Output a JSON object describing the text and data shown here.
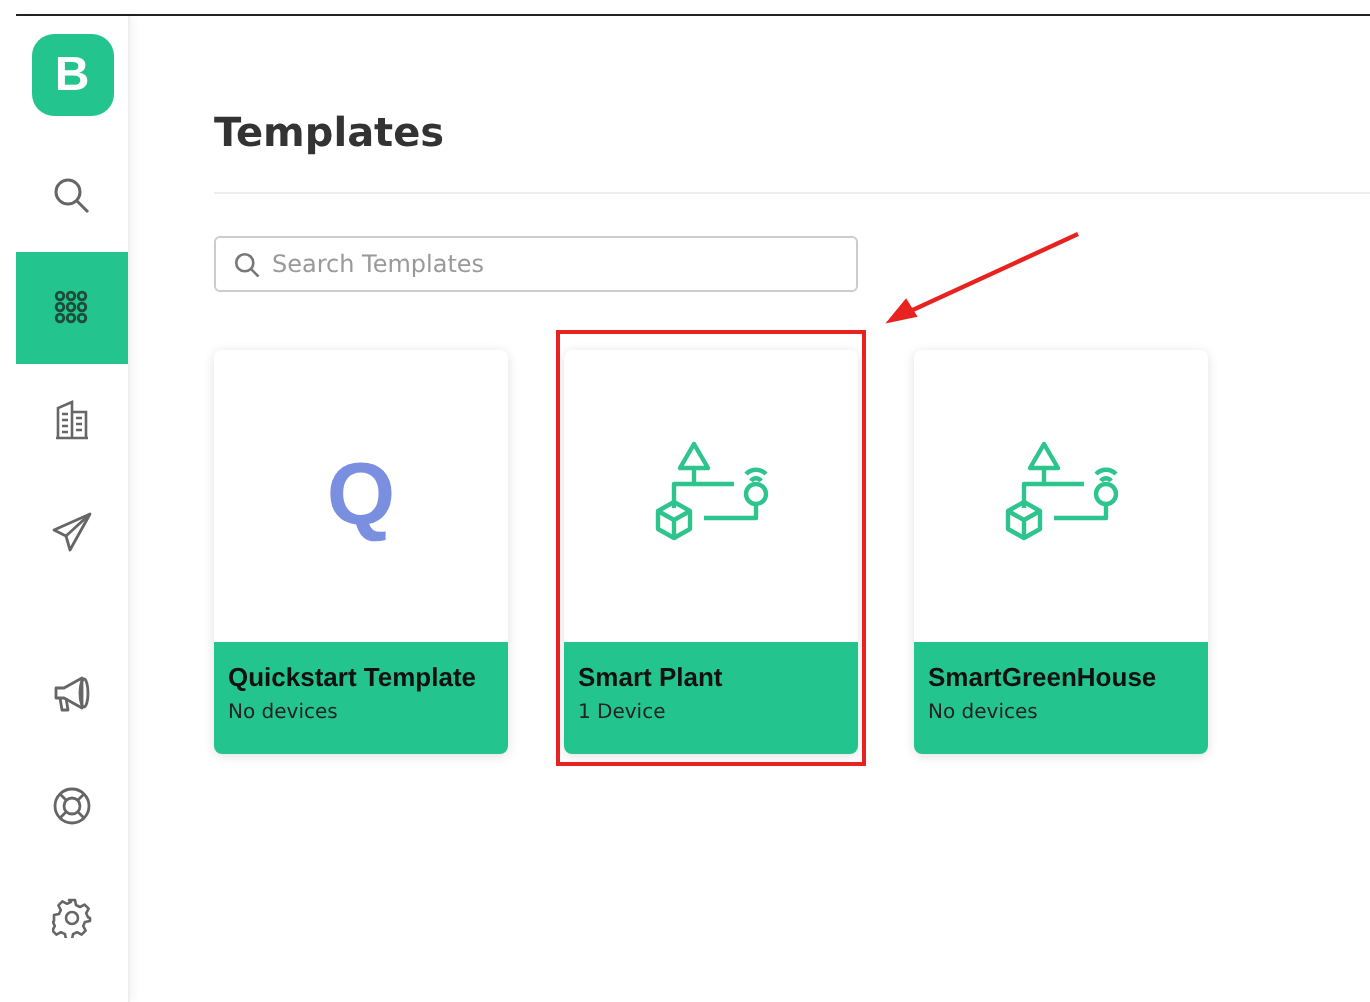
{
  "logo": {
    "letter": "B"
  },
  "sidebar": {
    "items": [
      {
        "kind": "search",
        "selected": false
      },
      {
        "kind": "templates",
        "selected": true
      },
      {
        "kind": "building",
        "selected": false
      },
      {
        "kind": "send",
        "selected": false
      },
      {
        "kind": "megaphone",
        "selected": false
      },
      {
        "kind": "lifebuoy",
        "selected": false
      },
      {
        "kind": "settings",
        "selected": false
      }
    ]
  },
  "page": {
    "title": "Templates"
  },
  "search": {
    "placeholder": "Search Templates"
  },
  "cards": [
    {
      "kind": "letter",
      "letter": "Q",
      "name": "Quickstart Template",
      "devices": "No devices",
      "highlighted": false
    },
    {
      "kind": "device",
      "name": "Smart Plant",
      "devices": "1 Device",
      "highlighted": true
    },
    {
      "kind": "device",
      "name": "SmartGreenHouse",
      "devices": "No devices",
      "highlighted": false
    }
  ]
}
